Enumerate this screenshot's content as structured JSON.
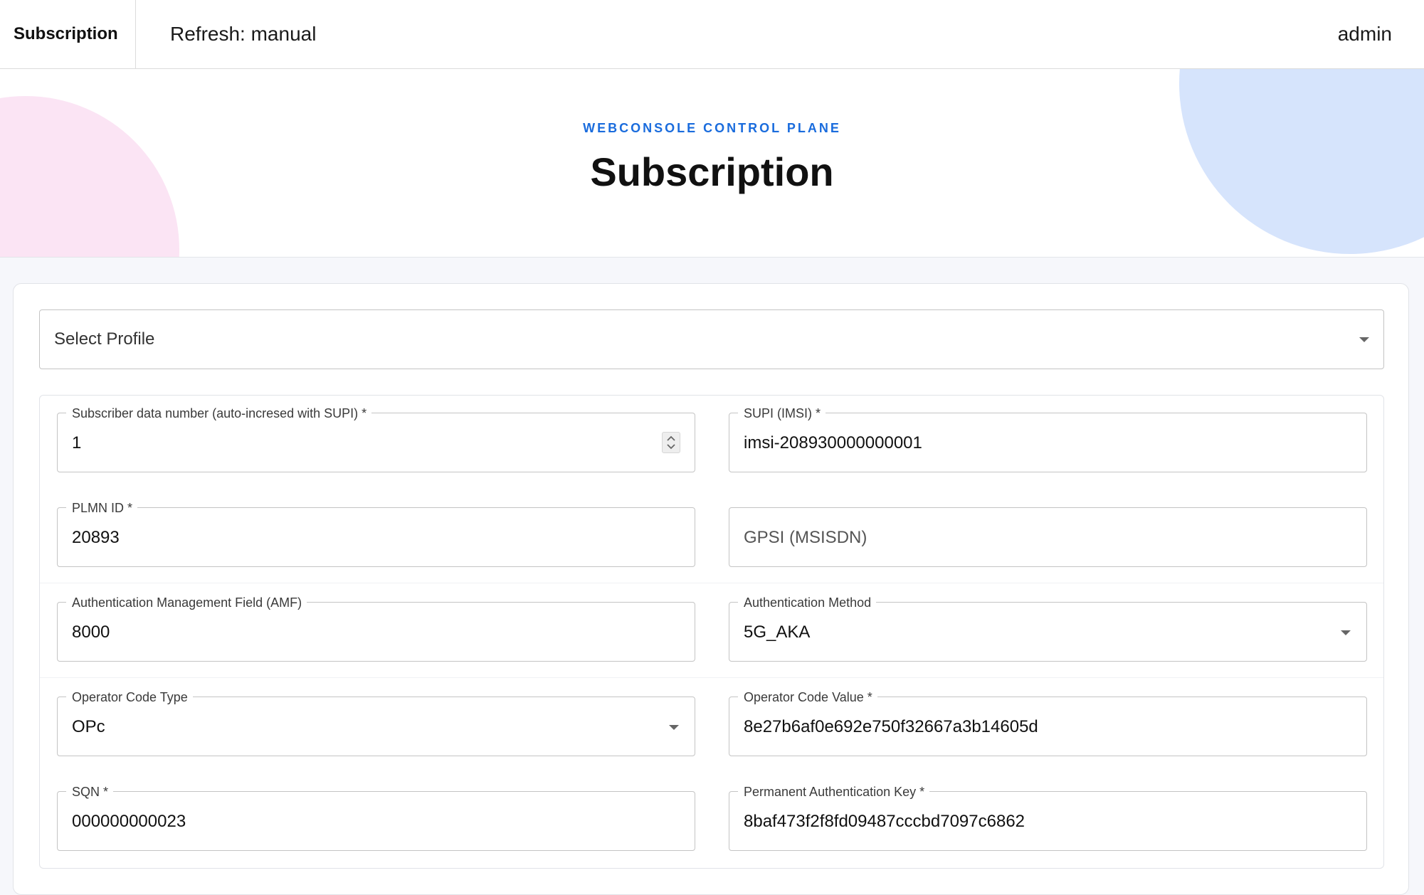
{
  "topbar": {
    "brand": "Subscription",
    "refresh": "Refresh: manual",
    "user": "admin"
  },
  "hero": {
    "eyebrow": "WEBCONSOLE CONTROL PLANE",
    "title": "Subscription"
  },
  "profile_select": {
    "placeholder": "Select Profile"
  },
  "fields": {
    "subscriber_number": {
      "label": "Subscriber data number (auto-incresed with SUPI) *",
      "value": "1"
    },
    "supi": {
      "label": "SUPI (IMSI) *",
      "value": "imsi-208930000000001"
    },
    "plmn_id": {
      "label": "PLMN ID *",
      "value": "20893"
    },
    "gpsi": {
      "placeholder": "GPSI (MSISDN)"
    },
    "amf": {
      "label": "Authentication Management Field (AMF)",
      "value": "8000"
    },
    "auth_method": {
      "label": "Authentication Method",
      "value": "5G_AKA"
    },
    "op_code_type": {
      "label": "Operator Code Type",
      "value": "OPc"
    },
    "op_code_value": {
      "label": "Operator Code Value *",
      "value": "8e27b6af0e692e750f32667a3b14605d"
    },
    "sqn": {
      "label": "SQN *",
      "value": "000000000023"
    },
    "permanent_key": {
      "label": "Permanent Authentication Key *",
      "value": "8baf473f2f8fd09487cccbd7097c6862"
    }
  },
  "icons": {
    "dropdown": "chevron-down-icon",
    "stepper": "number-stepper-icon"
  }
}
